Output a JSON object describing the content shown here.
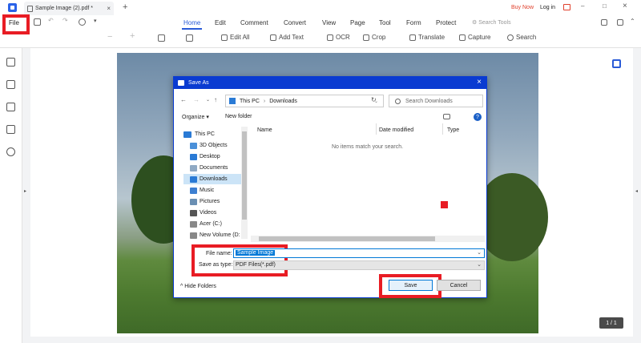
{
  "titlebar": {
    "tab_title": "Sample Image (2).pdf *",
    "close_tab": "×",
    "new_tab": "+",
    "buy_now": "Buy Now",
    "login": "Log in"
  },
  "menu": {
    "file": "File",
    "tabs": [
      "Home",
      "Edit",
      "Comment",
      "Convert",
      "View",
      "Page",
      "Tool",
      "Form",
      "Protect"
    ],
    "search_tools": "Search Tools"
  },
  "toolbar": {
    "edit_all": "Edit All",
    "add_text": "Add Text",
    "ocr": "OCR",
    "crop": "Crop",
    "translate": "Translate",
    "capture": "Capture",
    "search": "Search"
  },
  "dialog": {
    "title": "Save As",
    "breadcrumb": [
      "This PC",
      "Downloads"
    ],
    "search_placeholder": "Search Downloads",
    "organize": "Organize",
    "new_folder": "New folder",
    "columns": [
      "Name",
      "Date modified",
      "Type"
    ],
    "empty_message": "No items match your search.",
    "nav_items": [
      "This PC",
      "3D Objects",
      "Desktop",
      "Documents",
      "Downloads",
      "Music",
      "Pictures",
      "Videos",
      "Acer (C:)",
      "New Volume (D:"
    ],
    "file_name_label": "File name:",
    "file_name_value": "Sample Image",
    "save_type_label": "Save as type:",
    "save_type_value": "PDF Files(*.pdf)",
    "hide_folders": "Hide Folders",
    "save": "Save",
    "cancel": "Cancel"
  },
  "page_indicator": "1 / 1",
  "colors": {
    "accent": "#2a5bd7",
    "dialog_title": "#0a3bd1",
    "highlight": "#e81c24"
  }
}
